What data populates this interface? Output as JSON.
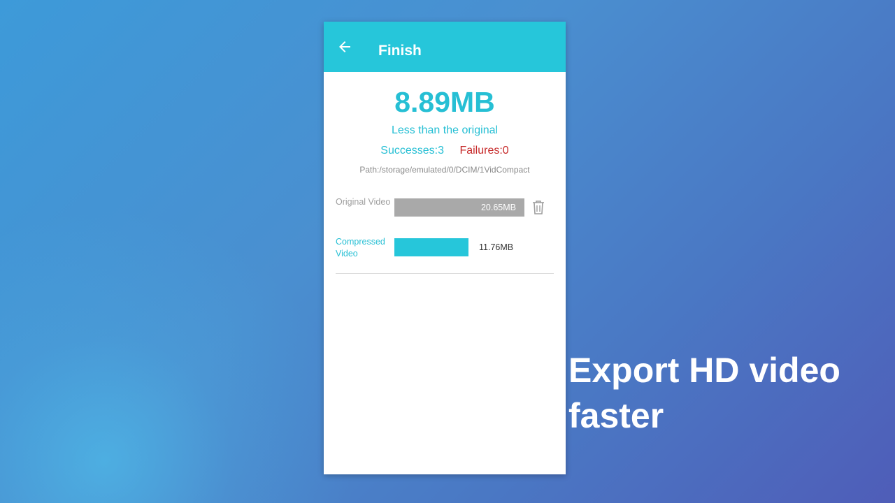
{
  "appbar": {
    "back_icon": "arrow-back-icon",
    "title": "Finish"
  },
  "summary": {
    "saved_size": "8.89MB",
    "saved_caption": "Less than the original",
    "successes": "Successes:3",
    "failures": "Failures:0",
    "path": "Path:/storage/emulated/0/DCIM/1VidCompact"
  },
  "comparison": {
    "original_label": "Original Video",
    "original_size": "20.65MB",
    "delete_icon": "trash-icon",
    "compressed_label": "Compressed Video",
    "compressed_size": "11.76MB"
  },
  "promo": {
    "line1": "Export HD video",
    "line2": "faster"
  },
  "colors": {
    "accent": "#26c6da",
    "failure": "#c62828",
    "original_bar": "#a9a9a9"
  }
}
